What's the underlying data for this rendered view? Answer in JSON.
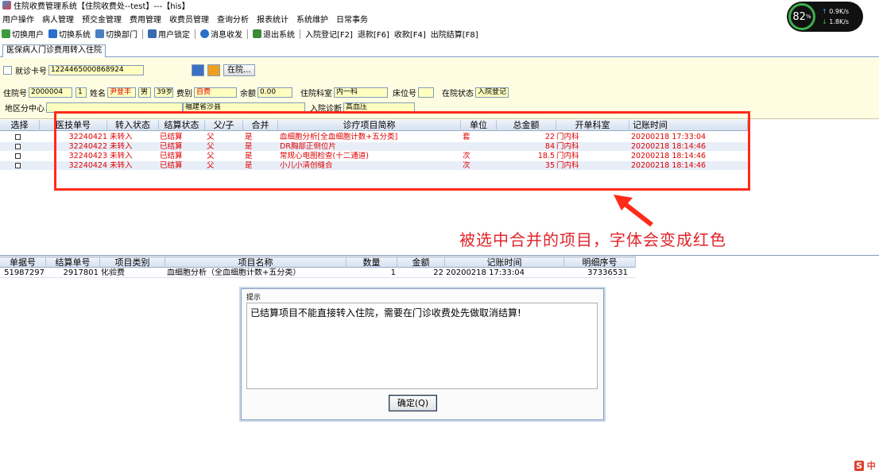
{
  "window": {
    "title": "住院收费管理系统【住院收费处--test】---【his】"
  },
  "speed_widget": {
    "percent": "82",
    "unit": "%",
    "up": "0.9",
    "down": "1.8",
    "rate_unit": "K/s"
  },
  "menu": [
    "用户操作",
    "病人管理",
    "预交金管理",
    "费用管理",
    "收费员管理",
    "查询分析",
    "报表统计",
    "系统维护",
    "日常事务"
  ],
  "toolbar": [
    {
      "label": "切换用户",
      "icon": "users-icon",
      "color": "#3c9a3c"
    },
    {
      "label": "切换系统",
      "icon": "switch-icon",
      "color": "#2a6fc9"
    },
    {
      "label": "切换部门",
      "icon": "department-icon",
      "color": "#4a7fc0"
    },
    {
      "label": "用户锁定",
      "icon": "lock-icon",
      "color": "#3a6ab0"
    },
    {
      "label": "消息收发",
      "icon": "info-icon",
      "color": "#2a6fc9"
    },
    {
      "label": "退出系统",
      "icon": "exit-icon",
      "color": "#3a8a3a"
    },
    {
      "label": "入院登记[F2]",
      "icon": "",
      "color": ""
    },
    {
      "label": "退款[F6]",
      "icon": "",
      "color": ""
    },
    {
      "label": "收款[F4]",
      "icon": "",
      "color": ""
    },
    {
      "label": "出院结算[F8]",
      "icon": "",
      "color": ""
    }
  ],
  "tab": {
    "label": "医保病人门诊费用转入住院"
  },
  "form": {
    "card_label": "就诊卡号",
    "card_value": "1224465000868924",
    "inhosp_button": "在院...",
    "admission_no_label": "住院号",
    "admission_no": "2000004",
    "times": "1",
    "name_label": "姓名",
    "name": "尹登丰",
    "gender": "男",
    "age": "39岁",
    "fee_type_label": "费别",
    "fee_type": "自费",
    "balance_label": "余额",
    "balance": "0.00",
    "dept_label": "住院科室",
    "dept": "内一科",
    "bed_label": "床位号",
    "bed": "",
    "status_label": "在院状态",
    "status": "入院登记",
    "region_label": "地区分中心",
    "region": "",
    "address": "福建省沙县",
    "diagnosis_label": "入院诊断",
    "diagnosis": "高血压"
  },
  "grid1": {
    "headers": [
      "选择",
      "医技单号",
      "转入状态",
      "结算状态",
      "父/子",
      "合并",
      "诊疗项目简称",
      "单位",
      "总金额",
      "开单科室",
      "记账时间"
    ],
    "rows": [
      {
        "no": "32240421",
        "transfer": "未转入",
        "settle": "已结算",
        "pc": "父",
        "merge": "是",
        "item": "血细胞分析[全血细胞计数+五分类]",
        "unit": "套",
        "amount": "22",
        "dept": "门内科",
        "time": "20200218 17:33:04"
      },
      {
        "no": "32240422",
        "transfer": "未转入",
        "settle": "已结算",
        "pc": "父",
        "merge": "是",
        "item": "DR胸部正侧位片",
        "unit": "",
        "amount": "84",
        "dept": "门内科",
        "time": "20200218 18:14:46"
      },
      {
        "no": "32240423",
        "transfer": "未转入",
        "settle": "已结算",
        "pc": "父",
        "merge": "是",
        "item": "常规心电图检查(十二通道)",
        "unit": "次",
        "amount": "18.5",
        "dept": "门内科",
        "time": "20200218 18:14:46"
      },
      {
        "no": "32240424",
        "transfer": "未转入",
        "settle": "已结算",
        "pc": "父",
        "merge": "是",
        "item": "小儿小清创缝合",
        "unit": "次",
        "amount": "35",
        "dept": "门内科",
        "time": "20200218 18:14:46"
      }
    ]
  },
  "annotation": "被选中合并的项目，字体会变成红色",
  "grid2": {
    "headers": [
      "单据号",
      "结算单号",
      "项目类别",
      "项目名称",
      "数量",
      "金额",
      "记账时间",
      "明细序号"
    ],
    "rows": [
      {
        "doc": "51987297",
        "settle_no": "2917801",
        "category": "化验费",
        "name": "血细胞分析（全血细胞计数+五分类）",
        "qty": "1",
        "amount": "22",
        "time": "20200218 17:33:04",
        "seq": "37336531"
      }
    ]
  },
  "dialog": {
    "title": "提示",
    "message": "已结算项目不能直接转入住院，需要在门诊收费处先做取消结算!",
    "ok": "确定(Q)"
  },
  "ime": "中"
}
